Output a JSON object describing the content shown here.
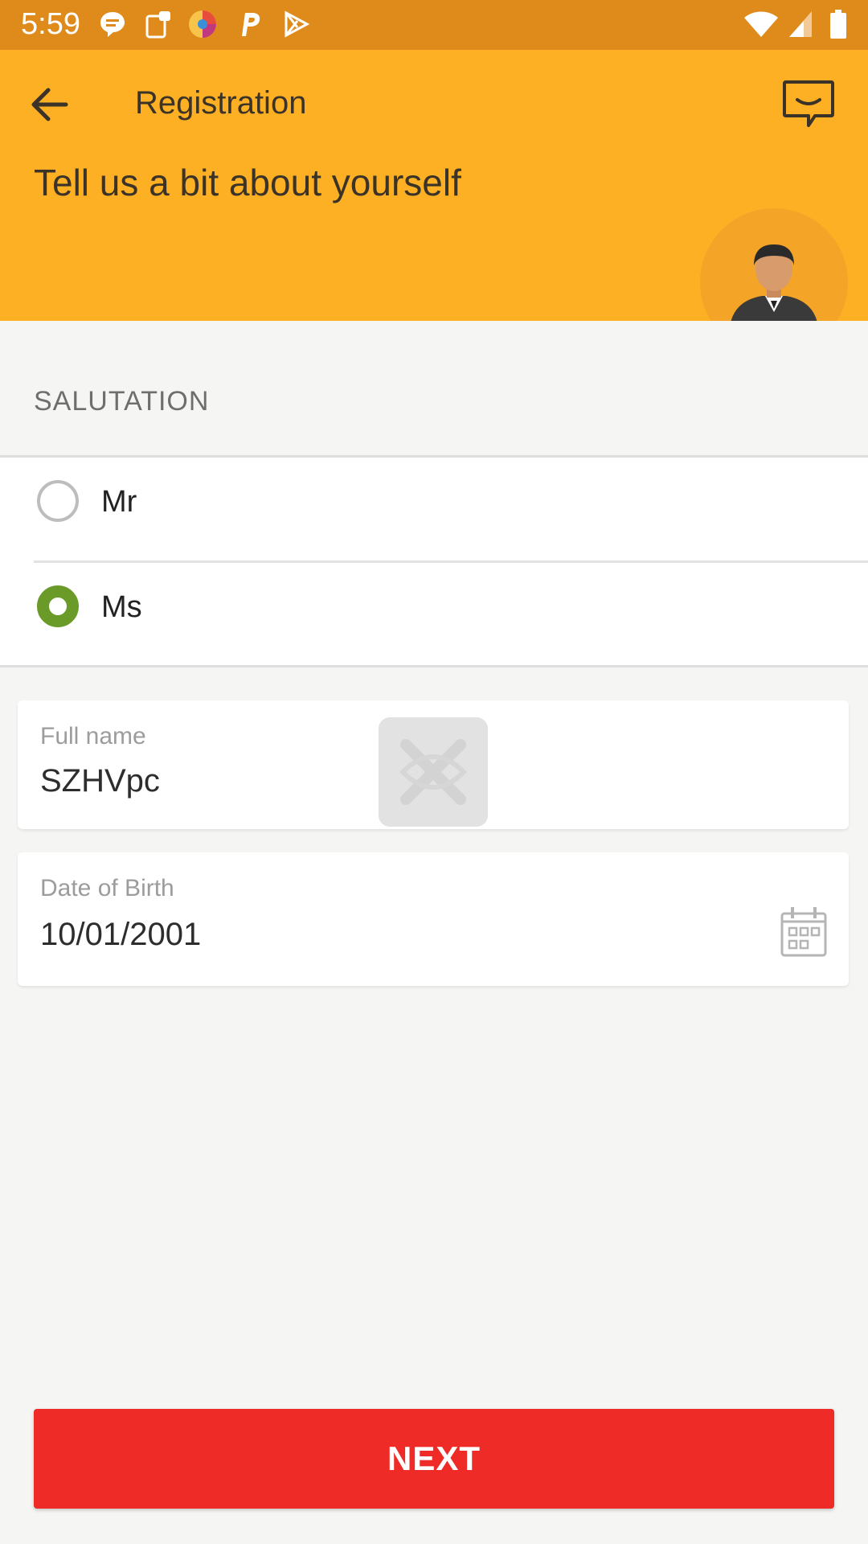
{
  "status_bar": {
    "time": "5:59",
    "icons": [
      "message-icon",
      "clipboard-icon",
      "browser-icon",
      "parking-icon",
      "play-store-icon",
      "wifi-icon",
      "signal-icon",
      "battery-icon"
    ]
  },
  "header": {
    "title": "Registration",
    "heading": "Tell us a bit about yourself",
    "back_icon": "arrow-left-icon",
    "chat_icon": "chat-icon"
  },
  "salutation": {
    "label": "SALUTATION",
    "options": [
      {
        "label": "Mr",
        "selected": false
      },
      {
        "label": "Ms",
        "selected": true
      }
    ]
  },
  "full_name": {
    "caption": "Full name",
    "value": "SZHVpc"
  },
  "dob": {
    "caption": "Date of Birth",
    "value": "10/01/2001"
  },
  "next_button": {
    "label": "NEXT"
  },
  "colors": {
    "status_bar": "#df8b1b",
    "header": "#fdb023",
    "radio_selected": "#6a9a27",
    "next_button": "#ee2b26"
  }
}
